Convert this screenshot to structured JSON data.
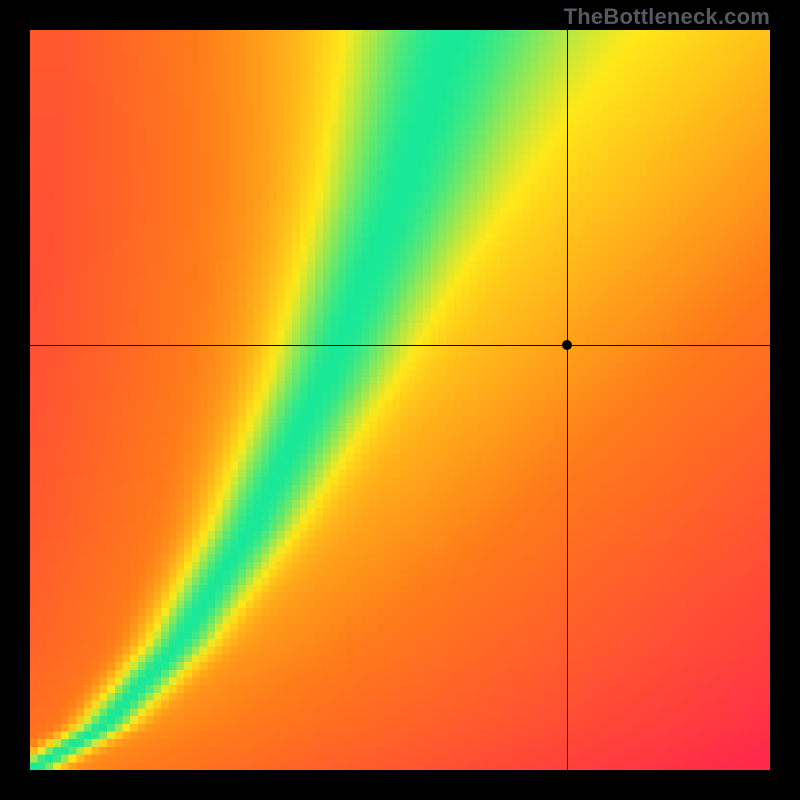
{
  "watermark": "TheBottleneck.com",
  "frame": {
    "outer_width": 800,
    "outer_height": 800,
    "inner_x": 30,
    "inner_y": 30,
    "inner_width": 740,
    "inner_height": 740,
    "pixelation": 96,
    "border_color": "#000000"
  },
  "crosshair": {
    "x_fraction": 0.725,
    "y_fraction": 0.425,
    "dot_radius_px": 5
  },
  "colors": {
    "red": "#ff2a4a",
    "orange": "#ff7a1a",
    "yellow": "#ffe81a",
    "green": "#18e898"
  },
  "chart_data": {
    "type": "heatmap",
    "title": "",
    "xlabel": "",
    "ylabel": "",
    "xlim": [
      0,
      1
    ],
    "ylim": [
      0,
      1
    ],
    "grid": false,
    "legend": false,
    "description": "2D heatmap over normalized (x,y) in [0,1]^2. Color encodes a closeness score in [0,1]: 1.0 on a diagonal ridge that rises from the bottom-left corner superlinearly toward the top, entering the top edge near x≈0.57; score falls off with horizontal distance from the ridge. Color scale: 0 → red, ~0.4 → orange, ~0.7 → yellow, 1 → green.",
    "ridge_control_points": [
      {
        "x": 0.0,
        "y": 0.0
      },
      {
        "x": 0.1,
        "y": 0.06
      },
      {
        "x": 0.2,
        "y": 0.17
      },
      {
        "x": 0.3,
        "y": 0.33
      },
      {
        "x": 0.4,
        "y": 0.53
      },
      {
        "x": 0.5,
        "y": 0.78
      },
      {
        "x": 0.57,
        "y": 1.0
      }
    ],
    "ridge_width_base": 0.022,
    "ridge_width_gain": 0.06,
    "floor_slope": 1.3,
    "color_stops": [
      {
        "t": 0.0,
        "hex": "#ff2a4a"
      },
      {
        "t": 0.4,
        "hex": "#ff7a1a"
      },
      {
        "t": 0.7,
        "hex": "#ffe81a"
      },
      {
        "t": 1.0,
        "hex": "#18e898"
      }
    ],
    "marker": {
      "x": 0.725,
      "y": 0.575
    }
  }
}
